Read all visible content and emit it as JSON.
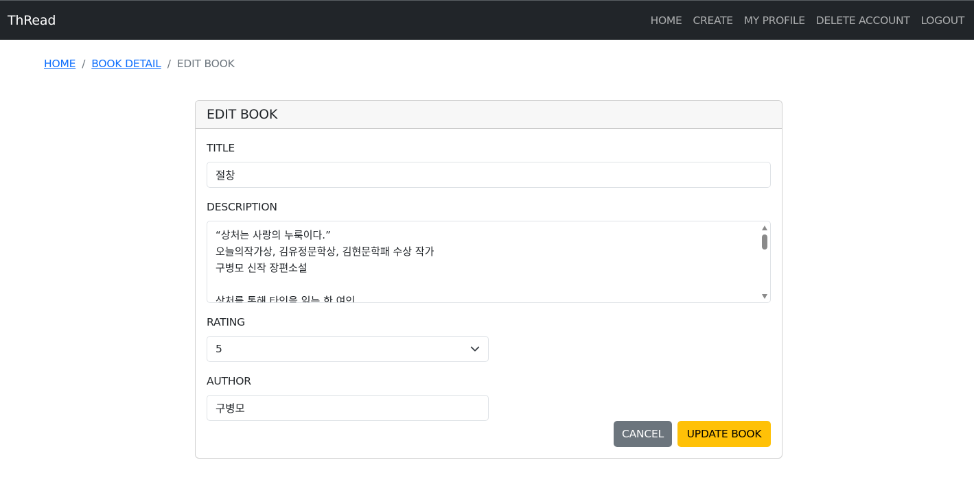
{
  "navbar": {
    "brand": "ThRead",
    "links": [
      "HOME",
      "CREATE",
      "MY PROFILE",
      "DELETE ACCOUNT",
      "LOGOUT"
    ]
  },
  "breadcrumb": {
    "items": [
      "HOME",
      "BOOK DETAIL"
    ],
    "active": "EDIT BOOK",
    "separator": "/"
  },
  "card": {
    "title": "EDIT BOOK"
  },
  "form": {
    "title_label": "TITLE",
    "title_value": "절창",
    "description_label": "DESCRIPTION",
    "description_value": "“상처는 사랑의 누룩이다.”\n오늘의작가상, 김유정문학상, 김현문학패 수상 작가\n구병모 신작 장편소설\n\n상처를 통해 타인을 읽는 한 여인",
    "rating_label": "RATING",
    "rating_value": "5",
    "author_label": "AUTHOR",
    "author_value": "구병모"
  },
  "buttons": {
    "cancel": "CANCEL",
    "update": "UPDATE BOOK"
  },
  "colors": {
    "navbar_bg": "#212529",
    "link": "#0d6efd",
    "cancel_bg": "#6c757d",
    "update_bg": "#ffc107"
  },
  "icons": {
    "select": "chevron-down-icon",
    "scroll_up": "scroll-up-arrow-icon",
    "scroll_down": "scroll-down-arrow-icon"
  }
}
